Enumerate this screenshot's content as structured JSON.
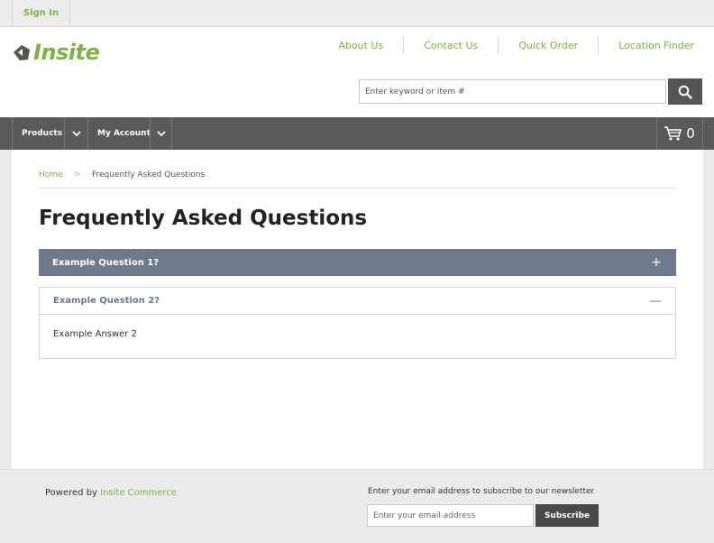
{
  "topbar": {
    "sign_in": "Sign In"
  },
  "header": {
    "logo_text": "Insite",
    "links": [
      "About Us",
      "Contact Us",
      "Quick Order",
      "Location Finder"
    ],
    "search_placeholder": "Enter keyword or item #"
  },
  "nav": {
    "products": "Products",
    "my_account": "My Account",
    "cart_count": "0"
  },
  "breadcrumb": {
    "home": "Home",
    "separator": ">",
    "current": "Frequently Asked Questions"
  },
  "page": {
    "title": "Frequently Asked Questions"
  },
  "faq": [
    {
      "question": "Example Question 1?",
      "toggle": "+",
      "expanded": false
    },
    {
      "question": "Example Question 2?",
      "toggle": "—",
      "expanded": true,
      "answer": "Example Answer 2"
    }
  ],
  "footer": {
    "powered_prefix": "Powered by ",
    "powered_link": "Insite Commerce",
    "newsletter_label": "Enter your email address to subscribe to our newsletter",
    "email_placeholder": "Enter your email address",
    "subscribe": "Subscribe"
  },
  "colors": {
    "accent_green": "#7cb342",
    "nav_bg": "#5a5a5a",
    "faq_header_bg": "#6c7a8b"
  }
}
